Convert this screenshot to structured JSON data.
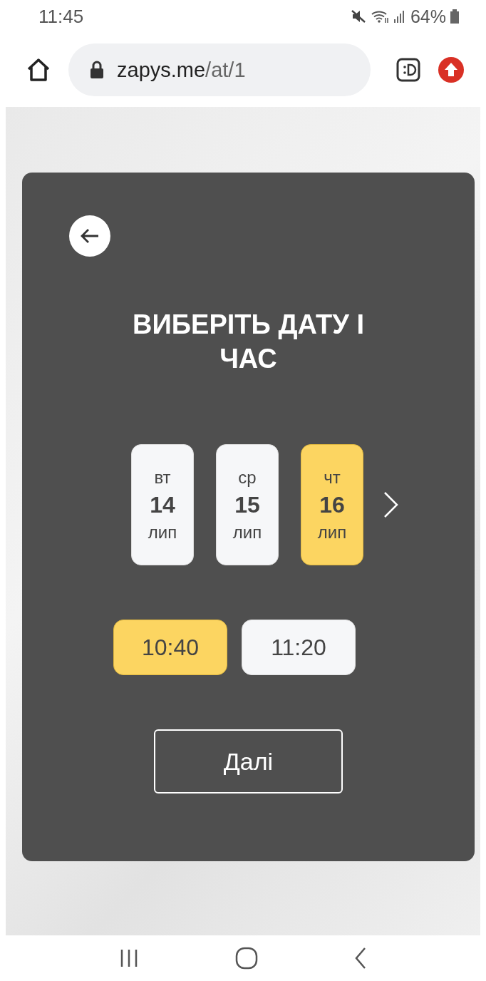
{
  "status_bar": {
    "time": "11:45",
    "battery": "64%"
  },
  "browser": {
    "url_host": "zapys.me",
    "url_path": "/at/1"
  },
  "card": {
    "title": "ВИБЕРІТЬ ДАТУ І ЧАС",
    "dates": [
      {
        "weekday": "вт",
        "day": "14",
        "month": "лип",
        "selected": false
      },
      {
        "weekday": "ср",
        "day": "15",
        "month": "лип",
        "selected": false
      },
      {
        "weekday": "чт",
        "day": "16",
        "month": "лип",
        "selected": true
      }
    ],
    "times": [
      {
        "label": "10:40",
        "selected": true
      },
      {
        "label": "11:20",
        "selected": false
      }
    ],
    "next_button": "Далі"
  }
}
